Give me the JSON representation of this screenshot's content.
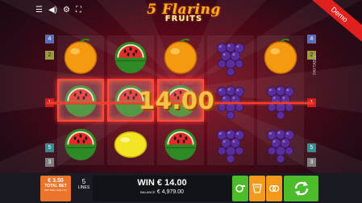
{
  "top_bar": {
    "icons": [
      "menu-icon",
      "speaker-icon",
      "settings-icon",
      "fullscreen-icon"
    ],
    "demo_label": "Demo"
  },
  "logo": {
    "line1": "5 Flaring",
    "line2": "FRUITS"
  },
  "reels": [
    [
      "orange",
      "watermelon",
      "watermelon"
    ],
    [
      "watermelon",
      "watermelon",
      "lemon"
    ],
    [
      "orange",
      "watermelon",
      "watermelon"
    ],
    [
      "grapes",
      "grapes",
      "grapes"
    ],
    [
      "orange",
      "grapes",
      "grapes"
    ]
  ],
  "winning_cells": [
    [
      0,
      1
    ],
    [
      1,
      1
    ],
    [
      2,
      1
    ]
  ],
  "win_display": "14.00",
  "line_indicators": {
    "left": [
      "4",
      "2",
      "1",
      "5",
      "3"
    ],
    "right": [
      "4",
      "2",
      "1",
      "5",
      "3"
    ]
  },
  "paytable_label": "PAYTABLE",
  "bet": {
    "value": "€ 3.50",
    "label": "TOTAL BET",
    "sub": "BET PER LINE 0.70"
  },
  "lines": {
    "value": "5",
    "label": "LINES"
  },
  "win": {
    "label": "WIN",
    "value": "€ 14.00"
  },
  "balance": {
    "label": "BALANCE",
    "value": "€ 4,979.00"
  },
  "buttons": [
    "autoplay-icon",
    "gamble-icon",
    "risk-icon",
    "spin-icon"
  ],
  "colors": {
    "accent": "#e0201e",
    "gold": "#f6b21a",
    "bet": "#e9742a",
    "orange_btn": "#f49a1a",
    "green_btn": "#4cbb2c"
  }
}
